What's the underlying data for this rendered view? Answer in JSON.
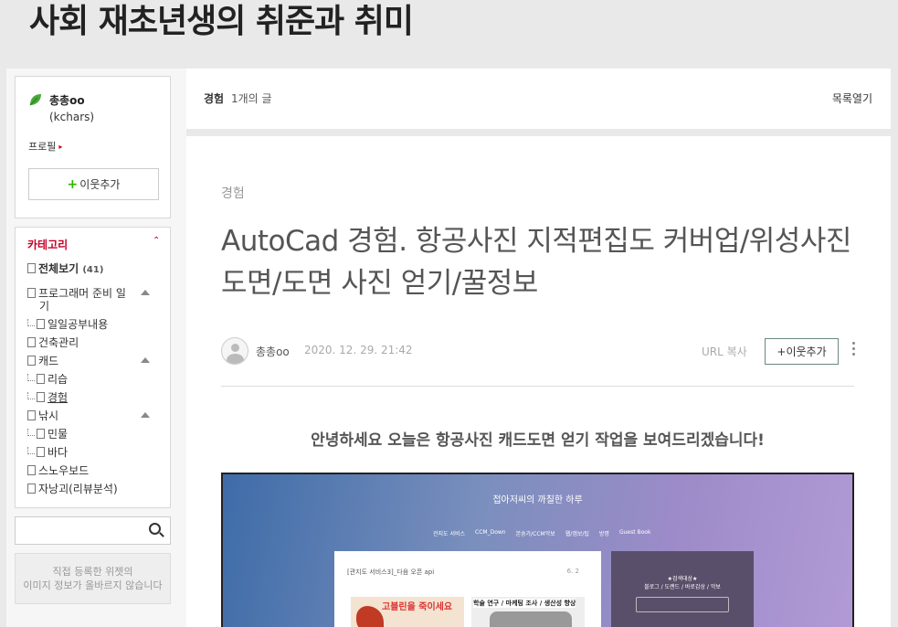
{
  "blog": {
    "title": "사회 재초년생의 취준과 취미"
  },
  "profile": {
    "nickname": "총총oo",
    "id": "(kchars)",
    "profile_link": "프로필",
    "add_neighbor": "이웃추가"
  },
  "category": {
    "header": "카테고리",
    "items": [
      {
        "label": "전체보기",
        "count": "(41)"
      },
      {
        "label": "프로그래머 준비 일"
      },
      {
        "label": "기"
      },
      {
        "label": "일일공부내용"
      },
      {
        "label": "건축관리"
      },
      {
        "label": "캐드"
      },
      {
        "label": "리습"
      },
      {
        "label": "경험"
      },
      {
        "label": "낚시"
      },
      {
        "label": "민물"
      },
      {
        "label": "바다"
      },
      {
        "label": "스노우보드"
      },
      {
        "label": "자낭괴(리뷰분석)"
      }
    ]
  },
  "search": {
    "placeholder": ""
  },
  "widget": {
    "line1": "직접 등록한 위젯의",
    "line2": "이미지 정보가 올바르지 않습니다"
  },
  "topbar": {
    "category": "경험",
    "count": "1개의 글",
    "list_open": "목록열기"
  },
  "post": {
    "category": "경험",
    "title": "AutoCad 경험. 항공사진 지적편집도 커버업/위성사진 도면/도면 사진 얻기/꿀정보",
    "author": "총총oo",
    "date": "2020. 12. 29. 21:42",
    "url_copy": "URL 복사",
    "add_neighbor": "+이웃추가",
    "greeting": "안녕하세요 오늘은 항공사진 캐드도면 얻기 작업을 보여드리겠습니다!"
  },
  "screenshot": {
    "site_title": "접아저씨의 까칠한 하루",
    "nav": [
      "관지도 서비스",
      "CCM_Down",
      "본숭가/CCM악보",
      "웹/앱보/팁",
      "방명",
      "Guest Book"
    ],
    "card_title": "[관지도 서비스3]_다음 오픈 api",
    "card_date": "6. 2",
    "thumb1_text": "고블린을 죽이세요",
    "thumb2_text": "학술 연구 / 마케팅 조사 / 생산성 향상",
    "side_line1": "★검색대상★",
    "side_line2": "블로그 / 도랜드 / 바로갑상 / 악보"
  },
  "colors": {
    "accent_green": "#2db400",
    "category_red": "#c4002b",
    "button_border": "#6a8a7b"
  }
}
